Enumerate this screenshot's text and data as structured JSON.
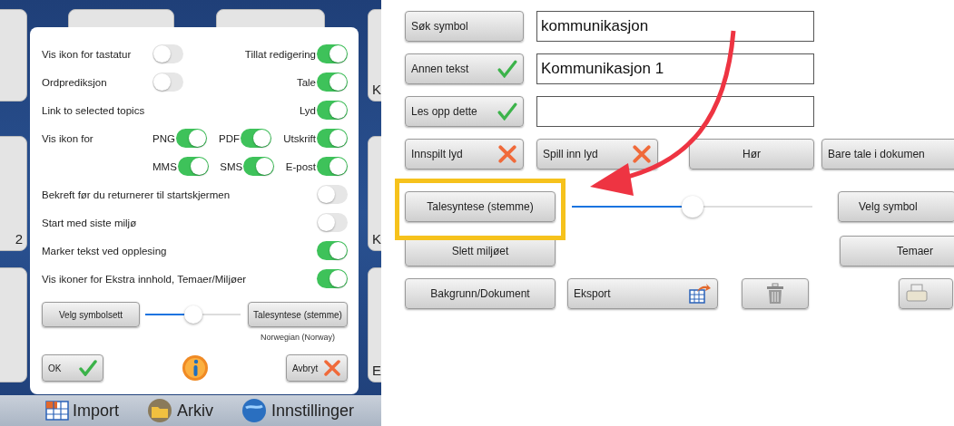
{
  "background": {
    "tile_labels": [
      "K",
      "2",
      "K",
      "E"
    ],
    "bottom_bar": [
      {
        "label": "Import",
        "kind": "table"
      },
      {
        "label": "Arkiv",
        "kind": "folder"
      },
      {
        "label": "Innstillinger",
        "kind": "globe"
      }
    ]
  },
  "settings_dialog": {
    "rows": [
      {
        "label": "Vis ikon for tastatur",
        "toggles": [
          {
            "on": false
          },
          {
            "label": "Tillat redigering",
            "on": true
          }
        ]
      },
      {
        "label": "Ordprediksjon",
        "toggles": [
          {
            "on": false
          },
          {
            "label": "Tale",
            "on": true
          }
        ]
      },
      {
        "label": "Link to selected topics",
        "toggles": [
          {
            "label": "Lyd",
            "on": true
          }
        ]
      },
      {
        "label": "Vis ikon for",
        "toggles": [
          {
            "label": "PNG",
            "on": true
          },
          {
            "label": "PDF",
            "on": true
          },
          {
            "label": "Utskrift",
            "on": true
          }
        ]
      },
      {
        "toggles": [
          {
            "label": "MMS",
            "on": true
          },
          {
            "label": "SMS",
            "on": true
          },
          {
            "label": "E-post",
            "on": true
          }
        ]
      },
      {
        "label": "Bekreft før du returnerer til startskjermen",
        "toggles": [
          {
            "on": false
          }
        ]
      },
      {
        "label": "Start med siste miljø",
        "toggles": [
          {
            "on": false
          }
        ]
      },
      {
        "label": "Marker tekst ved opplesing",
        "toggles": [
          {
            "on": true
          }
        ]
      },
      {
        "label": "Vis ikoner for Ekstra innhold, Temaer/Miljøer",
        "toggles": [
          {
            "on": true
          }
        ]
      }
    ],
    "symbol_button": "Velg symbolsett",
    "slider": {
      "level": 0.5
    },
    "voice_button": "Talesyntese (stemme)",
    "voice_caption": "Norwegian (Norway)",
    "ok_button": "OK",
    "cancel_button": "Avbryt"
  },
  "editor": {
    "fields": [
      {
        "button": "Søk symbol",
        "value": "kommunikasjon"
      },
      {
        "button": "Annen tekst",
        "kind": "check",
        "value": "Kommunikasjon 1"
      },
      {
        "button": "Les opp dette",
        "kind": "check"
      }
    ],
    "sound_row": [
      {
        "label": "Innspilt lyd",
        "kind": "cross"
      },
      {
        "label": "Spill inn lyd",
        "kind": "cross"
      },
      {
        "label": "Hør"
      },
      {
        "label": "Bare tale i dokumen"
      }
    ],
    "voice_button": "Talesyntese (stemme)",
    "voice_highlighted": true,
    "slider": {
      "level": 0.5
    },
    "symbol_button": "Velg symbol",
    "delete_button": "Slett miljøet",
    "themes_button": "Temaer",
    "background_button": "Bakgrunn/Dokument",
    "export_button": "Eksport"
  }
}
